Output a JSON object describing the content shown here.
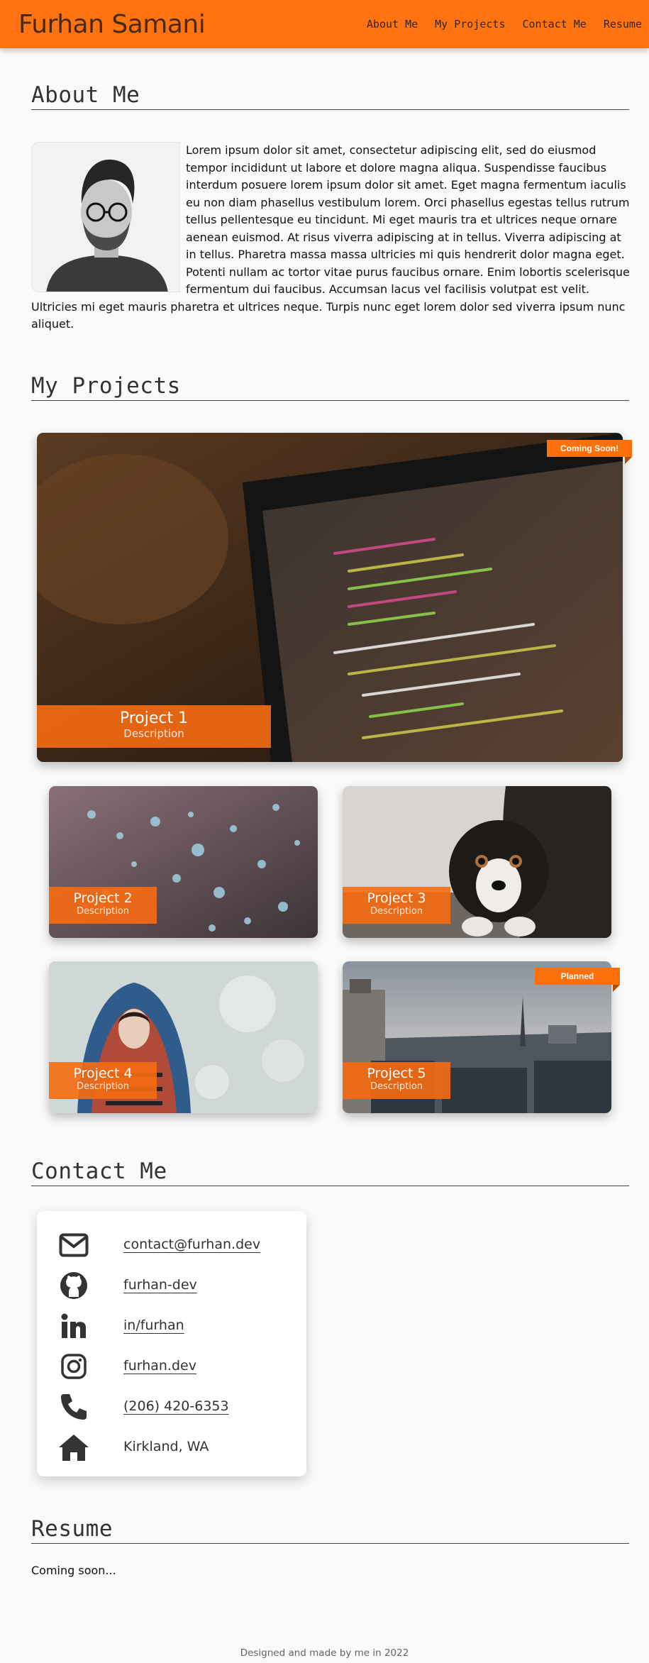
{
  "header": {
    "brand": "Furhan Samani",
    "nav": [
      "About Me",
      "My Projects",
      "Contact Me",
      "Resume"
    ]
  },
  "about": {
    "heading": "About Me",
    "bio": "Lorem ipsum dolor sit amet, consectetur adipiscing elit, sed do eiusmod tempor incididunt ut labore et dolore magna aliqua. Suspendisse faucibus interdum posuere lorem ipsum dolor sit amet. Eget magna fermentum iaculis eu non diam phasellus vestibulum lorem. Orci phasellus egestas tellus rutrum tellus pellentesque eu tincidunt. Mi eget mauris tra et ultrices neque ornare aenean euismod. At risus viverra adipiscing at in tellus. Viverra adipiscing at in tellus. Pharetra massa massa ultricies mi quis hendrerit dolor magna eget. Potenti nullam ac tortor vitae purus faucibus ornare. Enim lobortis scelerisque fermentum dui faucibus. Accumsan lacus vel facilisis volutpat est velit. Ultricies mi eget mauris pharetra et ultrices neque. Turpis nunc eget lorem dolor sed viverra ipsum nunc aliquet."
  },
  "projects": {
    "heading": "My Projects",
    "items": [
      {
        "title": "Project 1",
        "description": "Description",
        "badge": "Coming Soon!"
      },
      {
        "title": "Project 2",
        "description": "Description",
        "badge": ""
      },
      {
        "title": "Project 3",
        "description": "Description",
        "badge": ""
      },
      {
        "title": "Project 4",
        "description": "Description",
        "badge": ""
      },
      {
        "title": "Project 5",
        "description": "Description",
        "badge": "Planned"
      }
    ]
  },
  "contact": {
    "heading": "Contact Me",
    "items": [
      {
        "icon": "envelope-icon",
        "text": "contact@furhan.dev"
      },
      {
        "icon": "github-icon",
        "text": "furhan-dev"
      },
      {
        "icon": "linkedin-icon",
        "text": "in/furhan"
      },
      {
        "icon": "instagram-icon",
        "text": "furhan.dev"
      },
      {
        "icon": "phone-icon",
        "text": "(206) 420-6353"
      },
      {
        "icon": "home-icon",
        "text": "Kirkland, WA"
      }
    ]
  },
  "resume": {
    "heading": "Resume",
    "text": "Coming soon..."
  },
  "footer": "Designed and made by me in 2022",
  "colors": {
    "accent": "#ff7410",
    "label": "#f66c12"
  }
}
